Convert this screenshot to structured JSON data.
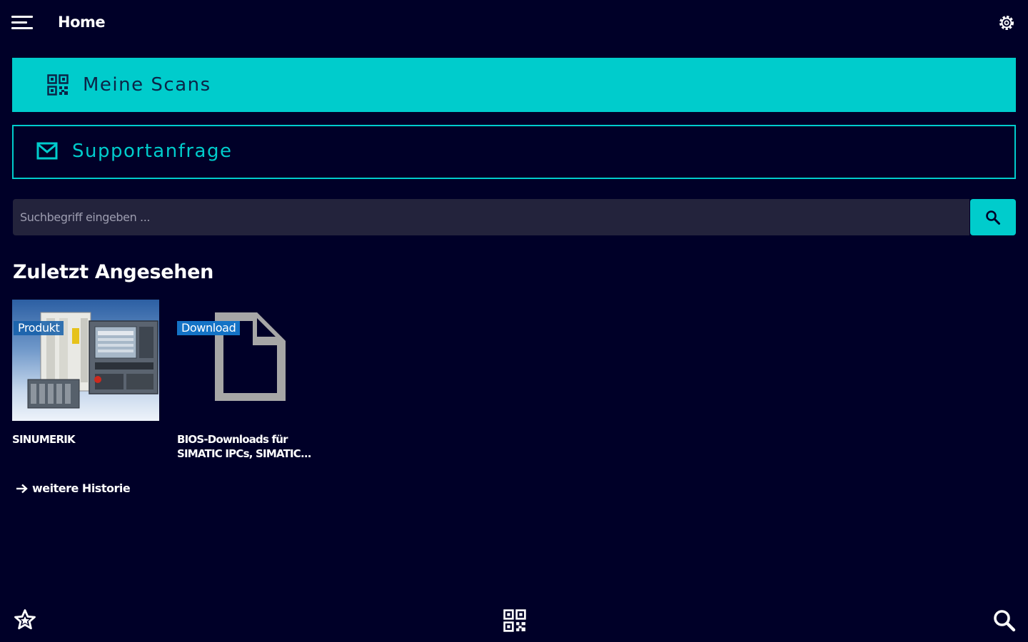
{
  "header": {
    "title": "Home",
    "menu_icon": "hamburger-menu-icon",
    "settings_icon": "gear-icon"
  },
  "actions": {
    "scans_label": "Meine Scans",
    "scans_icon": "qr-code-icon",
    "support_label": "Supportanfrage",
    "support_icon": "envelope-icon"
  },
  "search": {
    "placeholder": "Suchbegriff eingeben ...",
    "value": "",
    "button_icon": "search-icon"
  },
  "recent": {
    "title": "Zuletzt Angesehen",
    "items": [
      {
        "badge": "Produkt",
        "title": "SINUMERIK",
        "thumbnail": "product-image"
      },
      {
        "badge": "Download",
        "title": "BIOS-Downloads für SIMATIC IPCs, SIMATIC...",
        "thumbnail": "document-icon"
      }
    ],
    "more_label": "weitere Historie"
  },
  "bottom_nav": {
    "items": [
      "star-icon",
      "qr-code-icon",
      "search-icon"
    ]
  },
  "colors": {
    "background": "#000028",
    "accent": "#00cccc",
    "badge": "#1473c6",
    "input_bg": "#23233c"
  }
}
